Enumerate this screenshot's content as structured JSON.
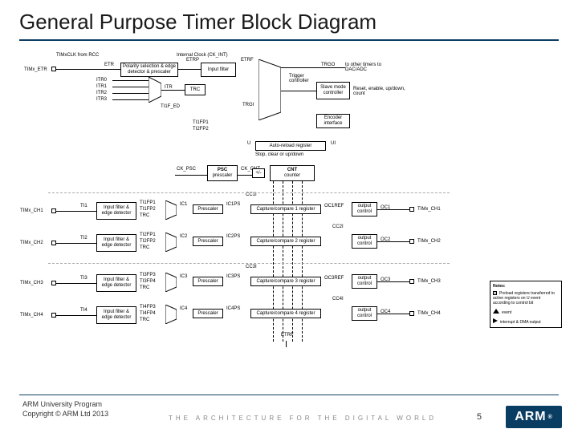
{
  "title": "General Purpose Timer Block Diagram",
  "footer_line1": "ARM University Program",
  "footer_line2": "Copyright © ARM Ltd 2013",
  "arch_line": "THE ARCHITECTURE FOR THE DIGITAL WORLD",
  "page_num": "5",
  "logo": "ARM",
  "top_clock": "Internal Clock (CK_INT)",
  "timx_clk": "TIMxCLK from RCC",
  "timx_etr": "TIMx_ETR",
  "etr": "ETR",
  "etrp": "ETRP",
  "etrf": "ETRF",
  "blk_polarity": "Polarity selection & edge detector & prescaler",
  "blk_inputfilter": "Input filter",
  "itr0": "ITR0",
  "itr1": "ITR1",
  "itr2": "ITR2",
  "itr3": "ITR3",
  "itr": "ITR",
  "trc": "TRC",
  "ti1f_ed": "TI1F_ED",
  "ti1fp1": "TI1FP1",
  "ti2fp2": "TI2FP2",
  "trgi": "TRGI",
  "trgo": "TRGO",
  "trgo_desc": "to other timers to DAC/ADC",
  "blk_trigctrl": "Trigger controller",
  "blk_slavemode": "Slave mode controller",
  "blk_encoder": "Encoder interface",
  "slave_out": "Reset, enable, up/down, count",
  "u_lbl": "U",
  "ui_lbl": "UI",
  "autoreload": "Auto-reload register",
  "stop_clear": "Stop, clear or up/down",
  "ck_psc": "CK_PSC",
  "ck_cnt": "CK_CNT",
  "psc_blk": "PSC",
  "psc_sub": "prescaler",
  "cnt_blk": "CNT",
  "cnt_sub": "counter",
  "plusminus": "+/-",
  "ch1": {
    "pin": "TIMx_CH1",
    "ti": "TI1",
    "filt": "Input filter & edge detector",
    "fp1": "TI1FP1",
    "fp2": "TI1FP2",
    "pres": "Prescaler",
    "ic": "IC1",
    "icps": "IC1PS",
    "cc": "CC1I",
    "cap": "Capture/compare 1 register",
    "oc_ref": "OC1REF",
    "out": "output control",
    "oc": "OC1"
  },
  "ch2": {
    "pin": "TIMx_CH2",
    "ti": "TI2",
    "filt": "Input filter & edge detector",
    "fp1": "TI2FP1",
    "fp2": "TI2FP2",
    "pres": "Prescaler",
    "ic": "IC2",
    "icps": "IC2PS",
    "cc": "CC2I",
    "cap": "Capture/compare 2 register",
    "out": "output control",
    "oc": "OC2"
  },
  "ch3": {
    "pin": "TIMx_CH3",
    "ti": "TI3",
    "filt": "Input filter & edge detector",
    "fp1": "TI3FP3",
    "fp2": "TI3FP4",
    "pres": "Prescaler",
    "ic": "IC3",
    "icps": "IC3PS",
    "cc": "CC3I",
    "cap": "Capture/compare 3 register",
    "oc_ref": "OC3REF",
    "out": "output control",
    "oc": "OC3"
  },
  "ch4": {
    "pin": "TIMx_CH4",
    "ti": "TI4",
    "filt": "Input filter & edge detector",
    "fp1": "TI4FP3",
    "fp2": "TI4FP4",
    "pres": "Prescaler",
    "ic": "IC4",
    "icps": "IC4PS",
    "cc": "CC4I",
    "cap": "Capture/compare 4 register",
    "out": "output control",
    "oc": "OC4"
  },
  "trc_lbl": "TRC",
  "etrf_bot": "ETRF",
  "notes_title": "Notes:",
  "notes_1": "Preload registers transferred to active registers on U event according to control bit",
  "notes_2": "event",
  "notes_3": "interrupt & DMA output"
}
